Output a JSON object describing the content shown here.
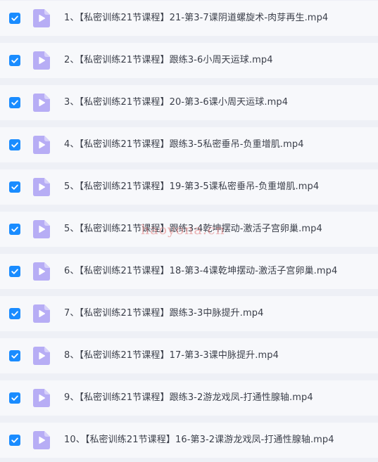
{
  "files": [
    {
      "name": "1、【私密训练21节课程】21-第3-7课阴道螺旋术-肉芽再生.mp4",
      "checked": true
    },
    {
      "name": "2、【私密训练21节课程】跟练3-6小周天运球.mp4",
      "checked": true
    },
    {
      "name": "3、【私密训练21节课程】20-第3-6课小周天运球.mp4",
      "checked": true
    },
    {
      "name": "4、【私密训练21节课程】跟练3-5私密垂吊-负重增肌.mp4",
      "checked": true
    },
    {
      "name": "5、【私密训练21节课程】19-第3-5课私密垂吊-负重增肌.mp4",
      "checked": true
    },
    {
      "name": "5、【私密训练21节课程】跟练3-4乾坤摆动-激活子宫卵巢.mp4",
      "checked": true
    },
    {
      "name": "6、【私密训练21节课程】18-第3-4课乾坤摆动-激活子宫卵巢.mp4",
      "checked": true
    },
    {
      "name": "7、【私密训练21节课程】跟练3-3中脉提升.mp4",
      "checked": true
    },
    {
      "name": "8、【私密训练21节课程】17-第3-3课中脉提升.mp4",
      "checked": true
    },
    {
      "name": "9、【私密训练21节课程】跟练3-2游龙戏凤-打通性腺轴.mp4",
      "checked": true
    },
    {
      "name": "10、【私密训练21节课程】16-第3-2课游龙戏凤-打通性腺轴.mp4",
      "checked": true
    }
  ],
  "watermark": "haoyona.cn",
  "colors": {
    "checkbox": "#1a8cff",
    "icon_body": "#b7adf5",
    "icon_fold": "#d6d0fa",
    "icon_play": "#ffffff",
    "row_bg": "#f7f8fb",
    "page_bg": "#eef0f6"
  },
  "icons": {
    "checkbox": "check-icon",
    "file": "video-file-icon"
  }
}
